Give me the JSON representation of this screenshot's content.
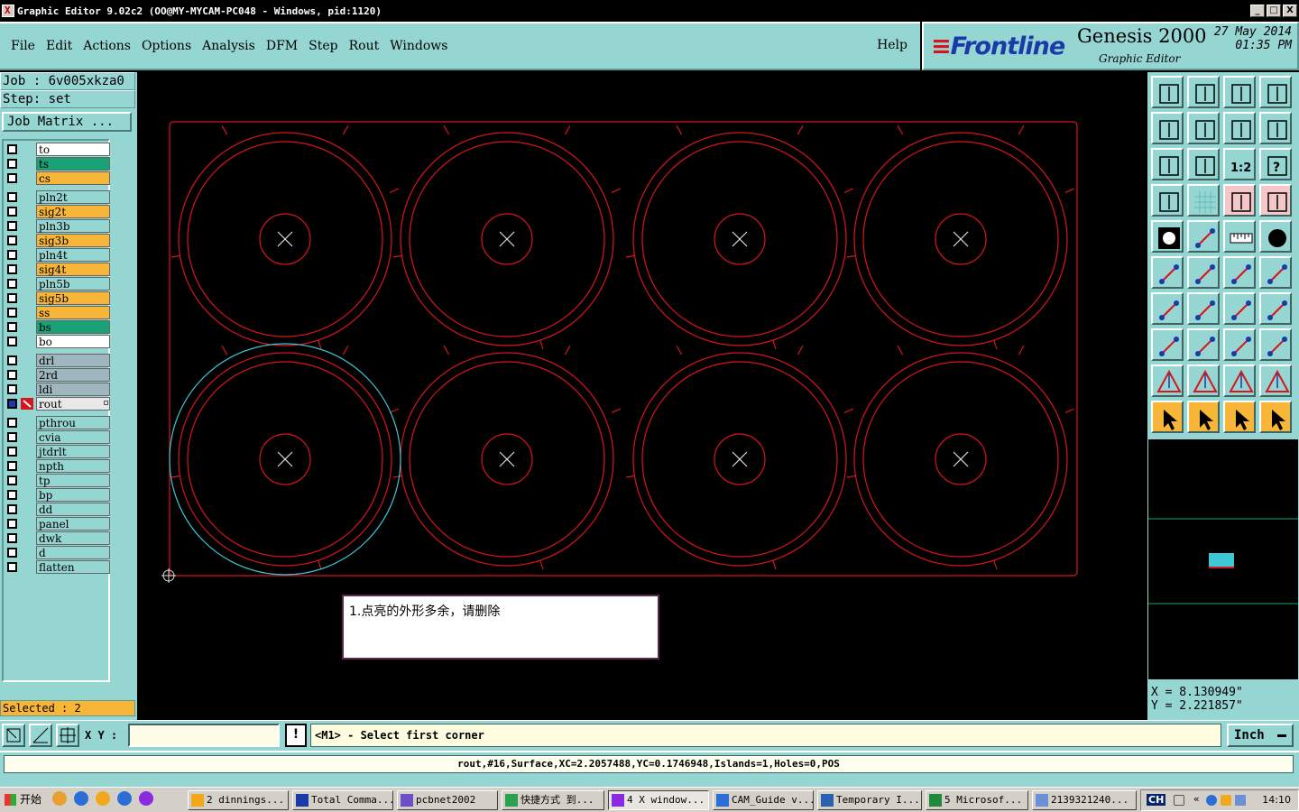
{
  "window": {
    "title": "Graphic Editor 9.02c2 (OO@MY-MYCAM-PC048 - Windows, pid:1120)",
    "buttons": [
      "_",
      "□",
      "X"
    ]
  },
  "menu": {
    "items": [
      {
        "label": "File",
        "name": "menu-file"
      },
      {
        "label": "Edit",
        "name": "menu-edit"
      },
      {
        "label": "Actions",
        "name": "menu-actions"
      },
      {
        "label": "Options",
        "name": "menu-options"
      },
      {
        "label": "Analysis",
        "name": "menu-analysis"
      },
      {
        "label": "DFM",
        "name": "menu-dfm"
      },
      {
        "label": "Step",
        "name": "menu-step"
      },
      {
        "label": "Rout",
        "name": "menu-rout"
      },
      {
        "label": "Windows",
        "name": "menu-windows"
      }
    ],
    "help": "Help"
  },
  "brand": {
    "logo": "Frontline",
    "product": "Genesis 2000",
    "subtitle": "Graphic Editor",
    "date": "27 May 2014",
    "time": "01:35 PM"
  },
  "job": {
    "job_line": "Job : 6v005xkza0",
    "step_line": "Step: set",
    "matrix_button": "Job Matrix ..."
  },
  "layers": [
    {
      "name": "to",
      "color": "#ffffff",
      "icon": ""
    },
    {
      "name": "ts",
      "color": "#1aa178",
      "icon": ""
    },
    {
      "name": "cs",
      "color": "#f8b638",
      "icon": ""
    },
    {
      "name": "pln2t",
      "color": "#95d5d2",
      "icon": "",
      "gap": true
    },
    {
      "name": "sig2t",
      "color": "#f8b638",
      "icon": ""
    },
    {
      "name": "pln3b",
      "color": "#95d5d2",
      "icon": ""
    },
    {
      "name": "sig3b",
      "color": "#f8b638",
      "icon": ""
    },
    {
      "name": "pln4t",
      "color": "#95d5d2",
      "icon": ""
    },
    {
      "name": "sig4t",
      "color": "#f8b638",
      "icon": ""
    },
    {
      "name": "pln5b",
      "color": "#95d5d2",
      "icon": ""
    },
    {
      "name": "sig5b",
      "color": "#f8b638",
      "icon": ""
    },
    {
      "name": "ss",
      "color": "#f8b638",
      "icon": ""
    },
    {
      "name": "bs",
      "color": "#1aa178",
      "icon": ""
    },
    {
      "name": "bo",
      "color": "#ffffff",
      "icon": ""
    },
    {
      "name": "drl",
      "color": "#9fb6bf",
      "icon": "",
      "gap": true
    },
    {
      "name": "2rd",
      "color": "#9fb6bf",
      "icon": ""
    },
    {
      "name": "ldi",
      "color": "#9fb6bf",
      "icon": ""
    },
    {
      "name": "rout",
      "color": "#e8e8e8",
      "icon": "rout-edit-icon",
      "active": true
    },
    {
      "name": "pthrou",
      "color": "#95d5d2",
      "icon": "",
      "gap": true
    },
    {
      "name": "cvia",
      "color": "#95d5d2",
      "icon": ""
    },
    {
      "name": "jtdrlt",
      "color": "#95d5d2",
      "icon": ""
    },
    {
      "name": "npth",
      "color": "#95d5d2",
      "icon": ""
    },
    {
      "name": "tp",
      "color": "#95d5d2",
      "icon": ""
    },
    {
      "name": "bp",
      "color": "#95d5d2",
      "icon": ""
    },
    {
      "name": "dd",
      "color": "#95d5d2",
      "icon": ""
    },
    {
      "name": "panel",
      "color": "#95d5d2",
      "icon": ""
    },
    {
      "name": "dwk",
      "color": "#95d5d2",
      "icon": ""
    },
    {
      "name": "d",
      "color": "#95d5d2",
      "icon": ""
    },
    {
      "name": "flatten",
      "color": "#95d5d2",
      "icon": ""
    }
  ],
  "selected": "Selected : 2",
  "note": "1.点亮的外形多余，请删除",
  "coords": {
    "x": "X = 8.130949\"",
    "y": "Y = 2.221857\""
  },
  "bottom": {
    "xy_label": "X Y :",
    "xy_value": "",
    "warn": "!",
    "prompt": "<M1> - Select first corner",
    "unit": "Inch"
  },
  "status": "rout,#16,Surface,XC=2.2057488,YC=0.1746948,Islands=1,Holes=0,POS",
  "taskbar": {
    "start": "开始",
    "items": [
      {
        "label": "2 dinnings...",
        "icon": "star-icon"
      },
      {
        "label": "Total Comma...",
        "icon": "floppy-icon"
      },
      {
        "label": "pcbnet2002",
        "icon": "app-icon"
      },
      {
        "label": "快捷方式 到...",
        "icon": "shortcut-icon"
      },
      {
        "label": "4 X window...",
        "icon": "x-window-icon",
        "active": true
      },
      {
        "label": "CAM_Guide v...",
        "icon": "cam-icon"
      },
      {
        "label": "Temporary I...",
        "icon": "word-icon"
      },
      {
        "label": "5 Microsof...",
        "icon": "excel-icon"
      },
      {
        "label": "2139321240...",
        "icon": "chat-icon"
      }
    ],
    "lang": "CH",
    "clock": "14:10"
  },
  "colors": {
    "panel": "#95d5d2",
    "outline": "#d8141e",
    "highlight": "#3ec8d6",
    "selected_bar": "#f8b638"
  }
}
